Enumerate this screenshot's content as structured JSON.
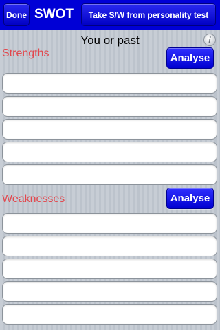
{
  "navbar": {
    "done_label": "Done",
    "title": "SWOT",
    "take_label": "Take S/W from personality test"
  },
  "subtitle": "You or past",
  "info_icon": "info-icon",
  "strengths": {
    "label": "Strengths",
    "analyse_label": "Analyse",
    "fields": [
      "",
      "",
      "",
      "",
      ""
    ]
  },
  "weaknesses": {
    "label": "Weaknesses",
    "analyse_label": "Analyse",
    "fields": [
      "",
      "",
      "",
      "",
      ""
    ]
  },
  "colors": {
    "navbar": "#0000d6",
    "button": "#0000d0",
    "section_label": "#e2474d",
    "background": "#c5ccd4"
  }
}
